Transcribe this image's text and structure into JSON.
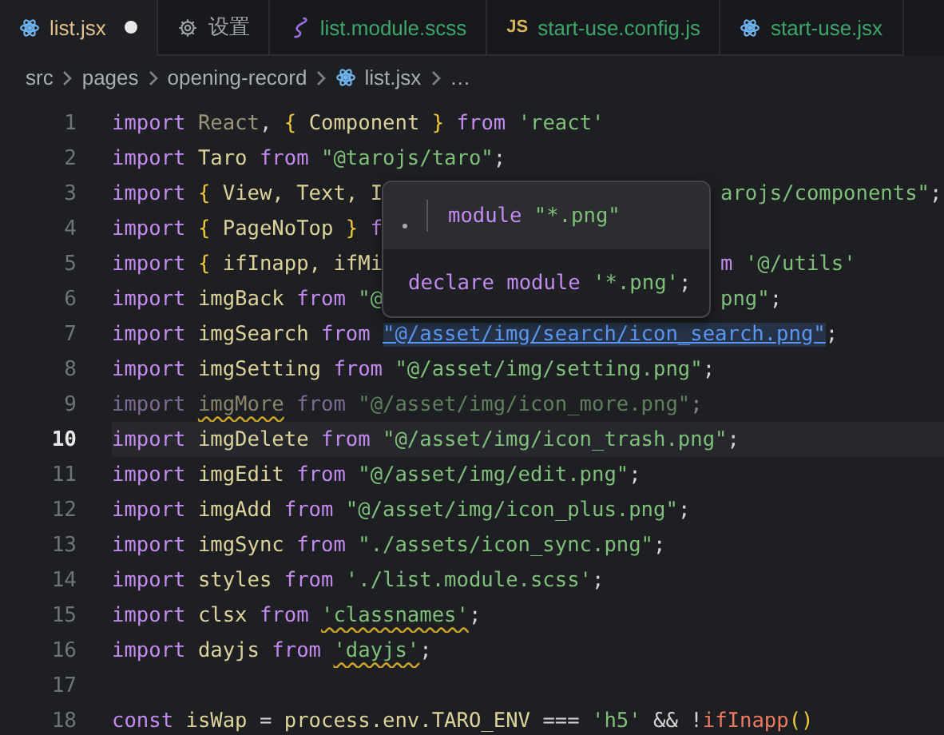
{
  "tabs": [
    {
      "label": "list.jsx",
      "kind": "react",
      "selected": true,
      "dirty": true,
      "color": "#e2c08d"
    },
    {
      "label": "设置",
      "kind": "gear",
      "selected": false,
      "dirty": false,
      "color": "#a0a3a8"
    },
    {
      "label": "list.module.scss",
      "kind": "sass",
      "selected": false,
      "dirty": false,
      "color": "#3fa66a"
    },
    {
      "label": "start-use.config.js",
      "kind": "js",
      "badge": "JS",
      "selected": false,
      "dirty": false,
      "color": "#3fa66a"
    },
    {
      "label": "start-use.jsx",
      "kind": "react",
      "selected": false,
      "dirty": false,
      "color": "#3fa66a"
    }
  ],
  "breadcrumb": [
    {
      "label": "src",
      "kind": "folder"
    },
    {
      "label": "pages",
      "kind": "folder"
    },
    {
      "label": "opening-record",
      "kind": "folder"
    },
    {
      "label": "list.jsx",
      "kind": "react"
    },
    {
      "label": "…",
      "kind": "more"
    }
  ],
  "lines": [
    {
      "n": "1",
      "current": false,
      "tokens": [
        {
          "t": "import ",
          "kind": "kw"
        },
        {
          "t": "React",
          "kind": "dimvar"
        },
        {
          "t": ", ",
          "kind": "punct"
        },
        {
          "t": "{",
          "kind": "brace"
        },
        {
          "t": " Component ",
          "kind": "var"
        },
        {
          "t": "}",
          "kind": "brace"
        },
        {
          "t": " from ",
          "kind": "kw"
        },
        {
          "t": "'react'",
          "kind": "str"
        }
      ]
    },
    {
      "n": "2",
      "current": false,
      "tokens": [
        {
          "t": "import ",
          "kind": "kw"
        },
        {
          "t": "Taro",
          "kind": "var"
        },
        {
          "t": " from ",
          "kind": "kw"
        },
        {
          "t": "\"@tarojs/taro\"",
          "kind": "str"
        },
        {
          "t": ";",
          "kind": "punct"
        }
      ]
    },
    {
      "n": "3",
      "current": false,
      "tokens": [
        {
          "t": "import ",
          "kind": "kw"
        },
        {
          "t": "{",
          "kind": "brace"
        },
        {
          "t": " View, Text, I",
          "kind": "var"
        }
      ],
      "tail": [
        {
          "t": "arojs/components\"",
          "kind": "str"
        },
        {
          "t": ";",
          "kind": "punct"
        }
      ]
    },
    {
      "n": "4",
      "current": false,
      "tokens": [
        {
          "t": "import ",
          "kind": "kw"
        },
        {
          "t": "{",
          "kind": "brace"
        },
        {
          "t": " PageNoTop ",
          "kind": "var"
        },
        {
          "t": "}",
          "kind": "brace"
        },
        {
          "t": " f",
          "kind": "kw"
        }
      ]
    },
    {
      "n": "5",
      "current": false,
      "tokens": [
        {
          "t": "import ",
          "kind": "kw"
        },
        {
          "t": "{",
          "kind": "brace"
        },
        {
          "t": " ifInapp, ifMi",
          "kind": "var"
        }
      ],
      "tail": [
        {
          "t": "m ",
          "kind": "kw"
        },
        {
          "t": "'@/utils'",
          "kind": "str"
        }
      ]
    },
    {
      "n": "6",
      "current": false,
      "tokens": [
        {
          "t": "import ",
          "kind": "kw"
        },
        {
          "t": "imgBack",
          "kind": "var"
        },
        {
          "t": " from ",
          "kind": "kw"
        },
        {
          "t": "\"@",
          "kind": "str"
        }
      ],
      "tail": [
        {
          "t": "png\"",
          "kind": "str"
        },
        {
          "t": ";",
          "kind": "punct"
        }
      ]
    },
    {
      "n": "7",
      "current": false,
      "tokens": [
        {
          "t": "import ",
          "kind": "kw"
        },
        {
          "t": "imgSearch",
          "kind": "var"
        },
        {
          "t": " from ",
          "kind": "kw"
        },
        {
          "t": "\"@/asset/img/search/icon_search.png\"",
          "kind": "link"
        },
        {
          "t": ";",
          "kind": "punct"
        }
      ]
    },
    {
      "n": "8",
      "current": false,
      "tokens": [
        {
          "t": "import ",
          "kind": "kw"
        },
        {
          "t": "imgSetting",
          "kind": "var"
        },
        {
          "t": " from ",
          "kind": "kw"
        },
        {
          "t": "\"@/asset/img/setting.png\"",
          "kind": "str"
        },
        {
          "t": ";",
          "kind": "punct"
        }
      ]
    },
    {
      "n": "9",
      "current": false,
      "tokens": [
        {
          "t": "import ",
          "kind": "dimkw"
        },
        {
          "t": "imgMore",
          "kind": "dimwarn"
        },
        {
          "t": " from ",
          "kind": "dimkw"
        },
        {
          "t": "\"@/asset/img/icon_more.png\"",
          "kind": "dimstr"
        },
        {
          "t": ";",
          "kind": "dimpunct"
        }
      ]
    },
    {
      "n": "10",
      "current": true,
      "tokens": [
        {
          "t": "import ",
          "kind": "kw"
        },
        {
          "t": "imgDelete",
          "kind": "var"
        },
        {
          "t": " from ",
          "kind": "kw"
        },
        {
          "t": "\"@/asset/img/icon_trash.png\"",
          "kind": "str"
        },
        {
          "t": ";",
          "kind": "punct"
        }
      ]
    },
    {
      "n": "11",
      "current": false,
      "tokens": [
        {
          "t": "import ",
          "kind": "kw"
        },
        {
          "t": "imgEdit",
          "kind": "var"
        },
        {
          "t": " from ",
          "kind": "kw"
        },
        {
          "t": "\"@/asset/img/edit.png\"",
          "kind": "str"
        },
        {
          "t": ";",
          "kind": "punct"
        }
      ]
    },
    {
      "n": "12",
      "current": false,
      "tokens": [
        {
          "t": "import ",
          "kind": "kw"
        },
        {
          "t": "imgAdd",
          "kind": "var"
        },
        {
          "t": " from ",
          "kind": "kw"
        },
        {
          "t": "\"@/asset/img/icon_plus.png\"",
          "kind": "str"
        },
        {
          "t": ";",
          "kind": "punct"
        }
      ]
    },
    {
      "n": "13",
      "current": false,
      "tokens": [
        {
          "t": "import ",
          "kind": "kw"
        },
        {
          "t": "imgSync",
          "kind": "var"
        },
        {
          "t": " from ",
          "kind": "kw"
        },
        {
          "t": "\"./assets/icon_sync.png\"",
          "kind": "str"
        },
        {
          "t": ";",
          "kind": "punct"
        }
      ]
    },
    {
      "n": "14",
      "current": false,
      "tokens": [
        {
          "t": "import ",
          "kind": "kw"
        },
        {
          "t": "styles",
          "kind": "var"
        },
        {
          "t": " from ",
          "kind": "kw"
        },
        {
          "t": "'./list.module.scss'",
          "kind": "str"
        },
        {
          "t": ";",
          "kind": "punct"
        }
      ]
    },
    {
      "n": "15",
      "current": false,
      "tokens": [
        {
          "t": "import ",
          "kind": "kw"
        },
        {
          "t": "clsx",
          "kind": "var"
        },
        {
          "t": " from ",
          "kind": "kw"
        },
        {
          "t": "'classnames'",
          "kind": "strwarn"
        },
        {
          "t": ";",
          "kind": "punct"
        }
      ]
    },
    {
      "n": "16",
      "current": false,
      "tokens": [
        {
          "t": "import ",
          "kind": "kw"
        },
        {
          "t": "dayjs",
          "kind": "var"
        },
        {
          "t": " from ",
          "kind": "kw"
        },
        {
          "t": "'dayjs'",
          "kind": "strwarn"
        },
        {
          "t": ";",
          "kind": "punct"
        }
      ]
    },
    {
      "n": "17",
      "current": false
    },
    {
      "n": "18",
      "current": false,
      "tokens": [
        {
          "t": "const ",
          "kind": "kw"
        },
        {
          "t": "isWap",
          "kind": "var"
        },
        {
          "t": " = ",
          "kind": "punct"
        },
        {
          "t": "process.env.TARO_ENV",
          "kind": "var"
        },
        {
          "t": " === ",
          "kind": "punct"
        },
        {
          "t": "'h5'",
          "kind": "str"
        },
        {
          "t": " && !",
          "kind": "punct"
        },
        {
          "t": "ifInapp",
          "kind": "fn"
        },
        {
          "t": "()",
          "kind": "brace"
        }
      ]
    }
  ],
  "popup": {
    "signature": [
      {
        "t": "module ",
        "kind": "kw"
      },
      {
        "t": "\"*.png\"",
        "kind": "str"
      }
    ],
    "declaration": [
      {
        "t": "declare module ",
        "kind": "kw"
      },
      {
        "t": "'*.png'",
        "kind": "str"
      },
      {
        "t": ";",
        "kind": "punct"
      }
    ]
  }
}
